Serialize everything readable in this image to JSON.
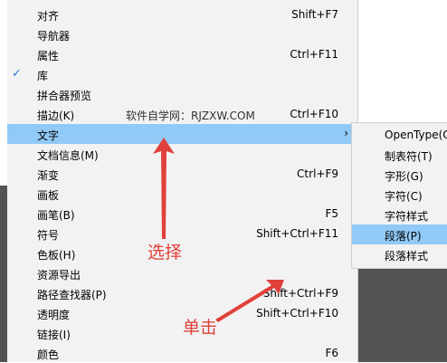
{
  "menu": {
    "items": [
      {
        "label": "对齐",
        "shortcut": "Shift+F7",
        "checked": false
      },
      {
        "label": "导航器",
        "shortcut": "",
        "checked": false
      },
      {
        "label": "属性",
        "shortcut": "Ctrl+F11",
        "checked": false
      },
      {
        "label": "库",
        "shortcut": "",
        "checked": true
      },
      {
        "label": "拼合器预览",
        "shortcut": "",
        "checked": false
      },
      {
        "label": "描边(K)",
        "shortcut": "Ctrl+F10",
        "checked": false
      },
      {
        "label": "文字",
        "shortcut": "",
        "checked": false,
        "highlighted": true,
        "submenu": true
      },
      {
        "label": "文档信息(M)",
        "shortcut": "",
        "checked": false
      },
      {
        "label": "渐变",
        "shortcut": "Ctrl+F9",
        "checked": false
      },
      {
        "label": "画板",
        "shortcut": "",
        "checked": false
      },
      {
        "label": "画笔(B)",
        "shortcut": "F5",
        "checked": false
      },
      {
        "label": "符号",
        "shortcut": "Shift+Ctrl+F11",
        "checked": false
      },
      {
        "label": "色板(H)",
        "shortcut": "",
        "checked": false
      },
      {
        "label": "资源导出",
        "shortcut": "",
        "checked": false
      },
      {
        "label": "路径查找器(P)",
        "shortcut": "Shift+Ctrl+F9",
        "checked": false
      },
      {
        "label": "透明度",
        "shortcut": "Shift+Ctrl+F10",
        "checked": false
      },
      {
        "label": "链接(I)",
        "shortcut": "",
        "checked": false
      },
      {
        "label": "颜色",
        "shortcut": "F6",
        "checked": false
      }
    ],
    "checkmark": "✓",
    "submenu_arrow": "›"
  },
  "watermark": "软件自学网：RJZXW.COM",
  "submenu": {
    "items": [
      {
        "label": "OpenType(O)"
      },
      {
        "label": "制表符(T)"
      },
      {
        "label": "字形(G)"
      },
      {
        "label": "字符(C)"
      },
      {
        "label": "字符样式"
      },
      {
        "label": "段落(P)",
        "highlighted": true
      },
      {
        "label": "段落样式"
      }
    ]
  },
  "annotations": {
    "select": "选择",
    "click": "单击",
    "color": "#e0413a"
  }
}
